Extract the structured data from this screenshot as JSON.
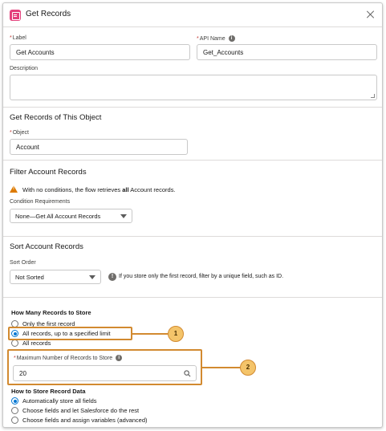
{
  "header": {
    "title": "Get Records"
  },
  "label_field": {
    "label": "Label",
    "value": "Get Accounts"
  },
  "api_name_field": {
    "label": "API Name",
    "value": "Get_Accounts"
  },
  "description_field": {
    "label": "Description",
    "value": ""
  },
  "object_section": {
    "title": "Get Records of This Object",
    "object_label": "Object",
    "object_value": "Account"
  },
  "filter_section": {
    "title": "Filter Account Records",
    "warning_prefix": "With no conditions, the flow retrieves",
    "warning_bold": "all",
    "warning_suffix": "Account records.",
    "condition_label": "Condition Requirements",
    "condition_value": "None—Get All Account Records"
  },
  "sort_section": {
    "title": "Sort Account Records",
    "order_label": "Sort Order",
    "order_value": "Not Sorted",
    "hint": "If you store only the first record, filter by a unique field, such as ID."
  },
  "store_section": {
    "title": "How Many Records to Store",
    "options": [
      "Only the first record",
      "All records, up to a specified limit",
      "All records"
    ],
    "selected_index": 1,
    "max_label": "Maximum Number of Records to Store",
    "max_value": "20"
  },
  "store_data_section": {
    "title": "How to Store Record Data",
    "options": [
      "Automatically store all fields",
      "Choose fields and let Salesforce do the rest",
      "Choose fields and assign variables (advanced)"
    ],
    "selected_index": 0
  },
  "callouts": {
    "first": "1",
    "second": "2"
  },
  "colors": {
    "accent": "#0176d3",
    "callout": "#d28a30",
    "warning": "#dd7a01",
    "header_icon": "#e4407b"
  }
}
